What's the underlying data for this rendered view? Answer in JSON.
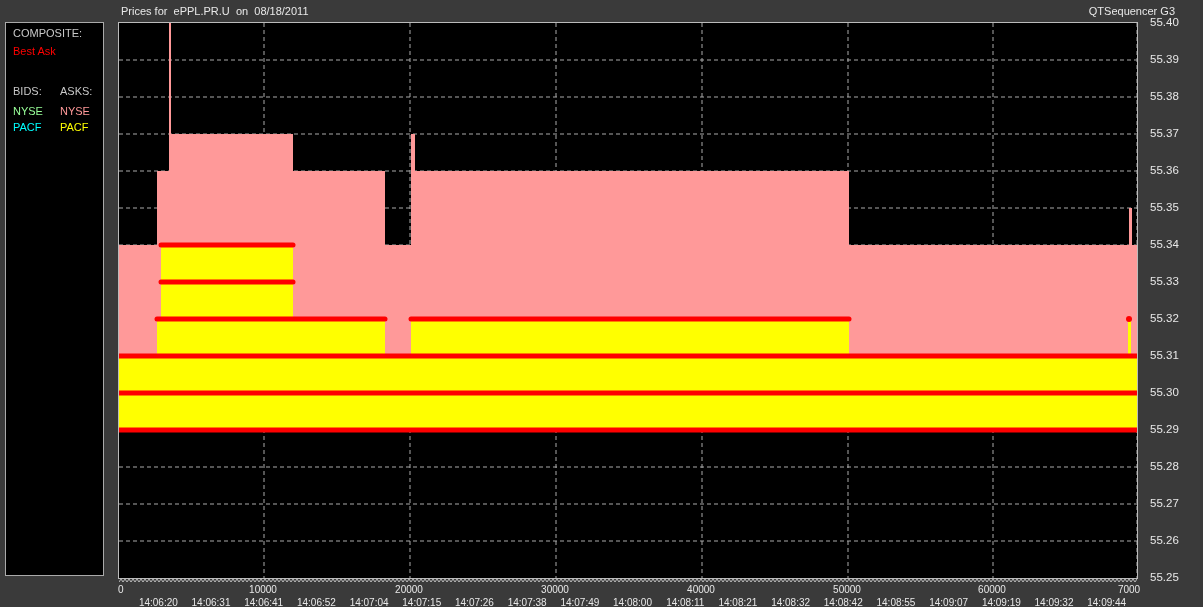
{
  "header": {
    "title": "Prices for  ePPL.PR.U  on  08/18/2011",
    "app_name": "QTSequencer G3"
  },
  "legend": {
    "composite_heading": "COMPOSITE:",
    "composite_items": [
      {
        "label": "Best Ask",
        "color": "#ff0000"
      }
    ],
    "bids_heading": "BIDS:",
    "asks_heading": "ASKS:",
    "bids": [
      {
        "label": "NYSE",
        "color": "#99ff99"
      },
      {
        "label": "PACF",
        "color": "#00ffff"
      }
    ],
    "asks": [
      {
        "label": "NYSE",
        "color": "#ff9999"
      },
      {
        "label": "PACF",
        "color": "#ffff00"
      }
    ]
  },
  "y_axis_labels": [
    "55.40",
    "55.39",
    "55.38",
    "55.37",
    "55.36",
    "55.35",
    "55.34",
    "55.33",
    "55.32",
    "55.31",
    "55.30",
    "55.29",
    "55.28",
    "55.27",
    "55.26",
    "55.25"
  ],
  "x_axis_numbers": [
    "0",
    "10000",
    "20000",
    "30000",
    "40000",
    "50000",
    "60000",
    "7000"
  ],
  "x_axis_times": [
    "14:06:20",
    "14:06:31",
    "14:06:41",
    "14:06:52",
    "14:07:04",
    "14:07:15",
    "14:07:26",
    "14:07:38",
    "14:07:49",
    "14:08:00",
    "14:08:11",
    "14:08:21",
    "14:08:32",
    "14:08:42",
    "14:08:55",
    "14:09:07",
    "14:09:19",
    "14:09:32",
    "14:09:44"
  ]
}
